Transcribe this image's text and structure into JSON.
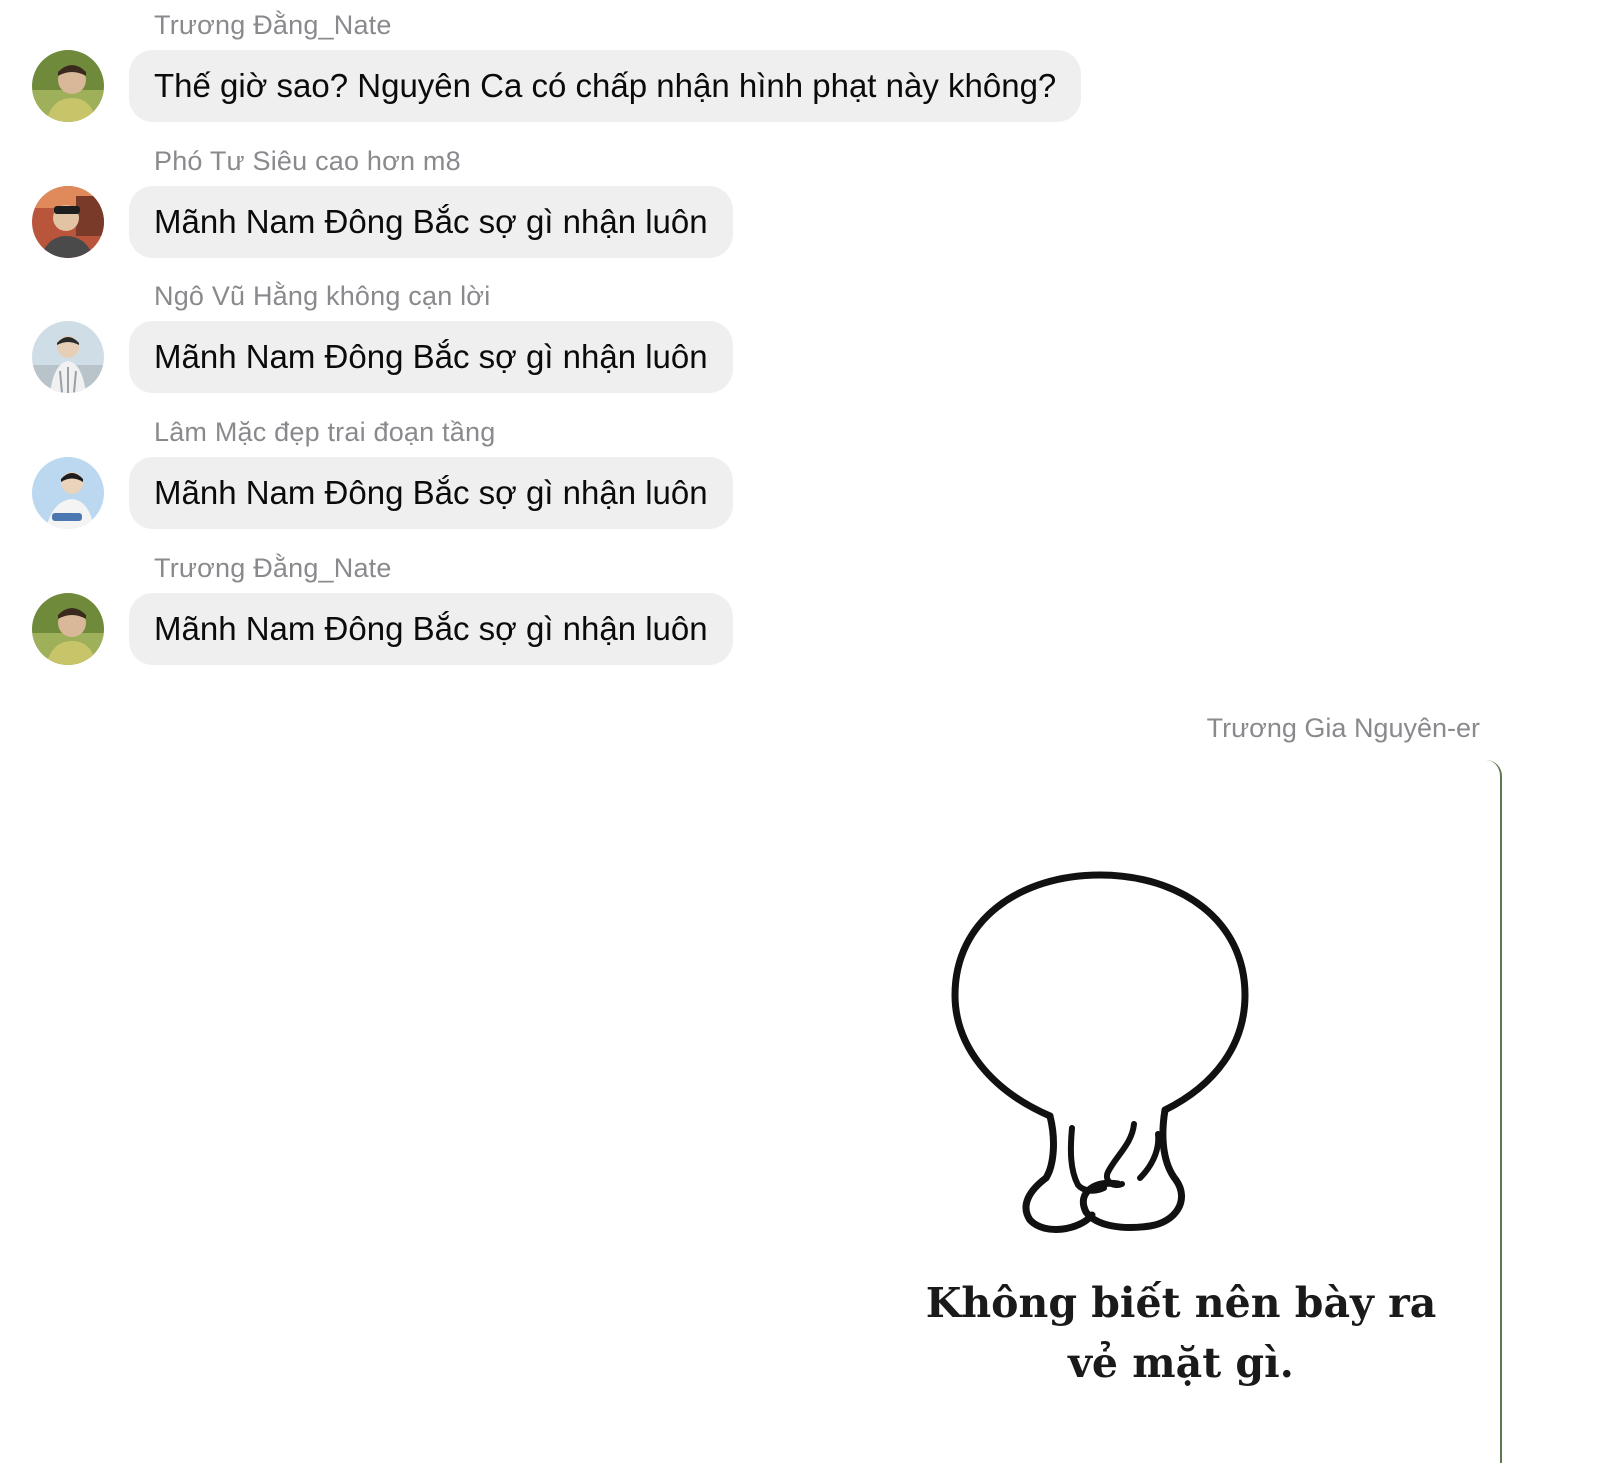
{
  "conversation": {
    "incoming": [
      {
        "sender": "Trương Đằng_Nate",
        "text": "Thế giờ sao? Nguyên Ca có chấp nhận hình phạt này không?",
        "avatar": "avatar-photo-green"
      },
      {
        "sender": "Phó Tư Siêu cao hơn m8",
        "text": "Mãnh Nam Đông Bắc sợ gì nhận luôn",
        "avatar": "avatar-photo-warm"
      },
      {
        "sender": "Ngô Vũ Hằng không cạn lời",
        "text": "Mãnh Nam Đông Bắc sợ gì nhận luôn",
        "avatar": "avatar-photo-sky"
      },
      {
        "sender": "Lâm Mặc đẹp trai đoạn tầng",
        "text": "Mãnh Nam Đông Bắc sợ gì nhận luôn",
        "avatar": "avatar-photo-blue"
      },
      {
        "sender": "Trương Đằng_Nate",
        "text": "Mãnh Nam Đông Bắc sợ gì nhận luôn",
        "avatar": "avatar-photo-green"
      }
    ],
    "outgoing": {
      "sender": "Trương Gia Nguyên-er",
      "sticker": {
        "icon": "blob-character-back-view-icon",
        "caption_line1": "Không biết nên bày ra",
        "caption_line2": "vẻ mặt gì."
      }
    }
  },
  "colors": {
    "bubble_bg": "#efeff0",
    "sender_text": "#8a8a8e",
    "message_text": "#0b0b0b",
    "sticker_border": "#5b7a4a"
  }
}
